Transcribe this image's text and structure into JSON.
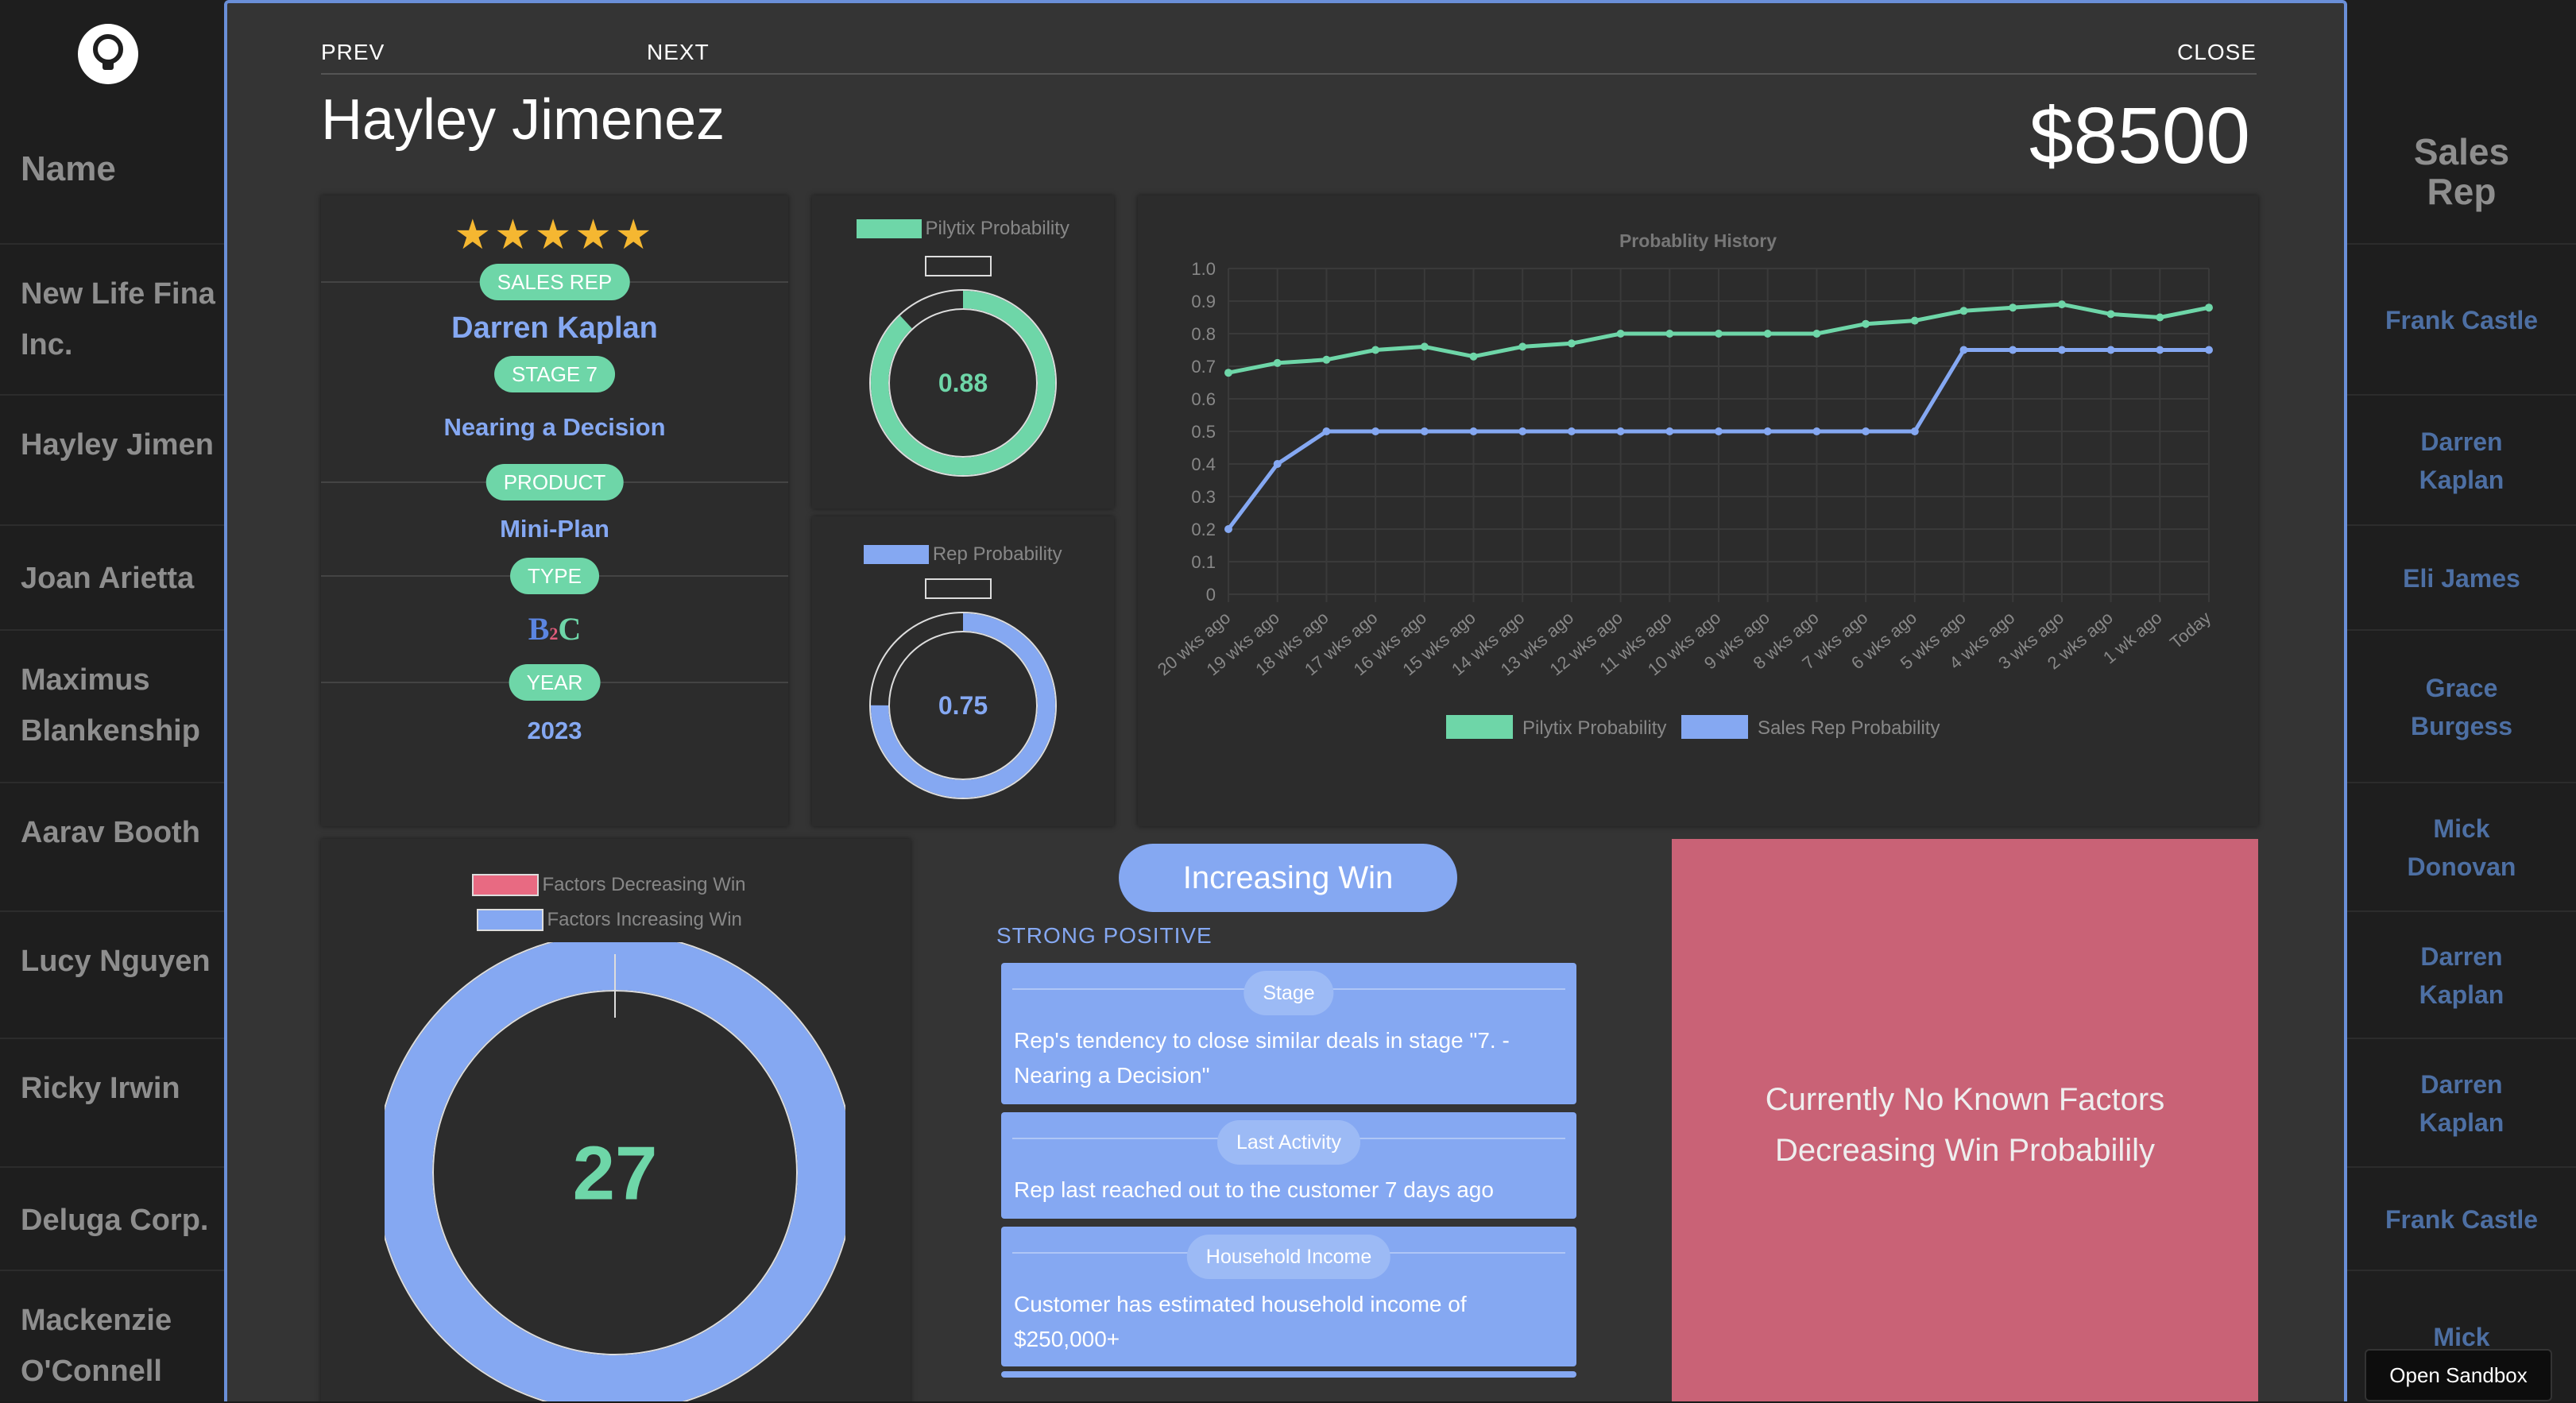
{
  "background_table": {
    "header_name": "Name",
    "header_rep": "Sales Rep",
    "rows": [
      {
        "name": "New Life Fina\nInc.",
        "rep": "Frank Castle"
      },
      {
        "name": "Hayley Jimen",
        "rep": "Darren Kaplan"
      },
      {
        "name": "Joan Arietta",
        "rep": "Eli James"
      },
      {
        "name": "Maximus Blankenship",
        "rep": "Grace Burgess"
      },
      {
        "name": "Aarav Booth",
        "rep": "Mick Donovan"
      },
      {
        "name": "Lucy Nguyen",
        "rep": "Darren Kaplan"
      },
      {
        "name": "Ricky Irwin",
        "rep": "Darren Kaplan"
      },
      {
        "name": "Deluga Corp.",
        "rep": "Frank Castle"
      },
      {
        "name": "Mackenzie O'Connell",
        "rep": "Mick"
      }
    ],
    "sandbox_label": "Open Sandbox"
  },
  "modal": {
    "prev_label": "PREV",
    "next_label": "NEXT",
    "close_label": "CLOSE",
    "customer_name": "Hayley Jimenez",
    "amount": "$8500"
  },
  "info": {
    "rating_stars": 5,
    "sales_rep_label": "SALES REP",
    "sales_rep": "Darren Kaplan",
    "stage_label": "STAGE 7",
    "stage": "Nearing a Decision",
    "product_label": "PRODUCT",
    "product": "Mini-Plan",
    "type_label": "TYPE",
    "type_b": "B",
    "type_c": "C",
    "year_label": "YEAR",
    "year": "2023"
  },
  "pilytix_donut": {
    "legend": "Pilytix Probability",
    "value": 0.88,
    "value_label": "0.88",
    "color": "#6ed6a8"
  },
  "rep_donut": {
    "legend": "Rep Probability",
    "value": 0.75,
    "value_label": "0.75",
    "color": "#85a8f2"
  },
  "factors_donut": {
    "legend_decreasing": "Factors Decreasing Win",
    "legend_increasing": "Factors Increasing Win",
    "value_label": "27",
    "decreasing": 0,
    "increasing": 27,
    "dec_color": "#e86a82",
    "inc_color": "#85a8f2"
  },
  "chart_data": {
    "type": "line",
    "title": "Probablity History",
    "categories": [
      "20 wks ago",
      "19 wks ago",
      "18 wks ago",
      "17 wks ago",
      "16 wks ago",
      "15 wks ago",
      "14 wks ago",
      "13 wks ago",
      "12 wks ago",
      "11 wks ago",
      "10 wks ago",
      "9 wks ago",
      "8 wks ago",
      "7 wks ago",
      "6 wks ago",
      "5 wks ago",
      "4 wks ago",
      "3 wks ago",
      "2 wks ago",
      "1 wk ago",
      "Today"
    ],
    "series": [
      {
        "name": "Pilytix Probability",
        "color": "#6ed6a8",
        "values": [
          0.68,
          0.71,
          0.72,
          0.75,
          0.76,
          0.73,
          0.76,
          0.77,
          0.8,
          0.8,
          0.8,
          0.8,
          0.8,
          0.83,
          0.84,
          0.87,
          0.88,
          0.89,
          0.86,
          0.85,
          0.88
        ]
      },
      {
        "name": "Sales Rep Probability",
        "color": "#85a8f2",
        "values": [
          0.2,
          0.4,
          0.5,
          0.5,
          0.5,
          0.5,
          0.5,
          0.5,
          0.5,
          0.5,
          0.5,
          0.5,
          0.5,
          0.5,
          0.5,
          0.75,
          0.75,
          0.75,
          0.75,
          0.75,
          0.75
        ]
      }
    ],
    "yticks": [
      "1.0",
      "0.9",
      "0.8",
      "0.7",
      "0.6",
      "0.5",
      "0.4",
      "0.3",
      "0.2",
      "0.1",
      "0"
    ],
    "ylim": [
      0,
      1.0
    ],
    "grid": true,
    "legend_position": "bottom"
  },
  "win_factors": {
    "button_label": "Increasing Win",
    "section_label": "STRONG POSITIVE",
    "items": [
      {
        "tag": "Stage",
        "desc": "Rep's tendency to close similar deals in stage \"7. - Nearing a Decision\""
      },
      {
        "tag": "Last Activity",
        "desc": "Rep last reached out to the customer 7 days ago"
      },
      {
        "tag": "Household Income",
        "desc": "Customer has estimated household income of $250,000+"
      }
    ]
  },
  "decreasing": {
    "message": "Currently No Known Factors Decreasing Win Probabilily"
  }
}
